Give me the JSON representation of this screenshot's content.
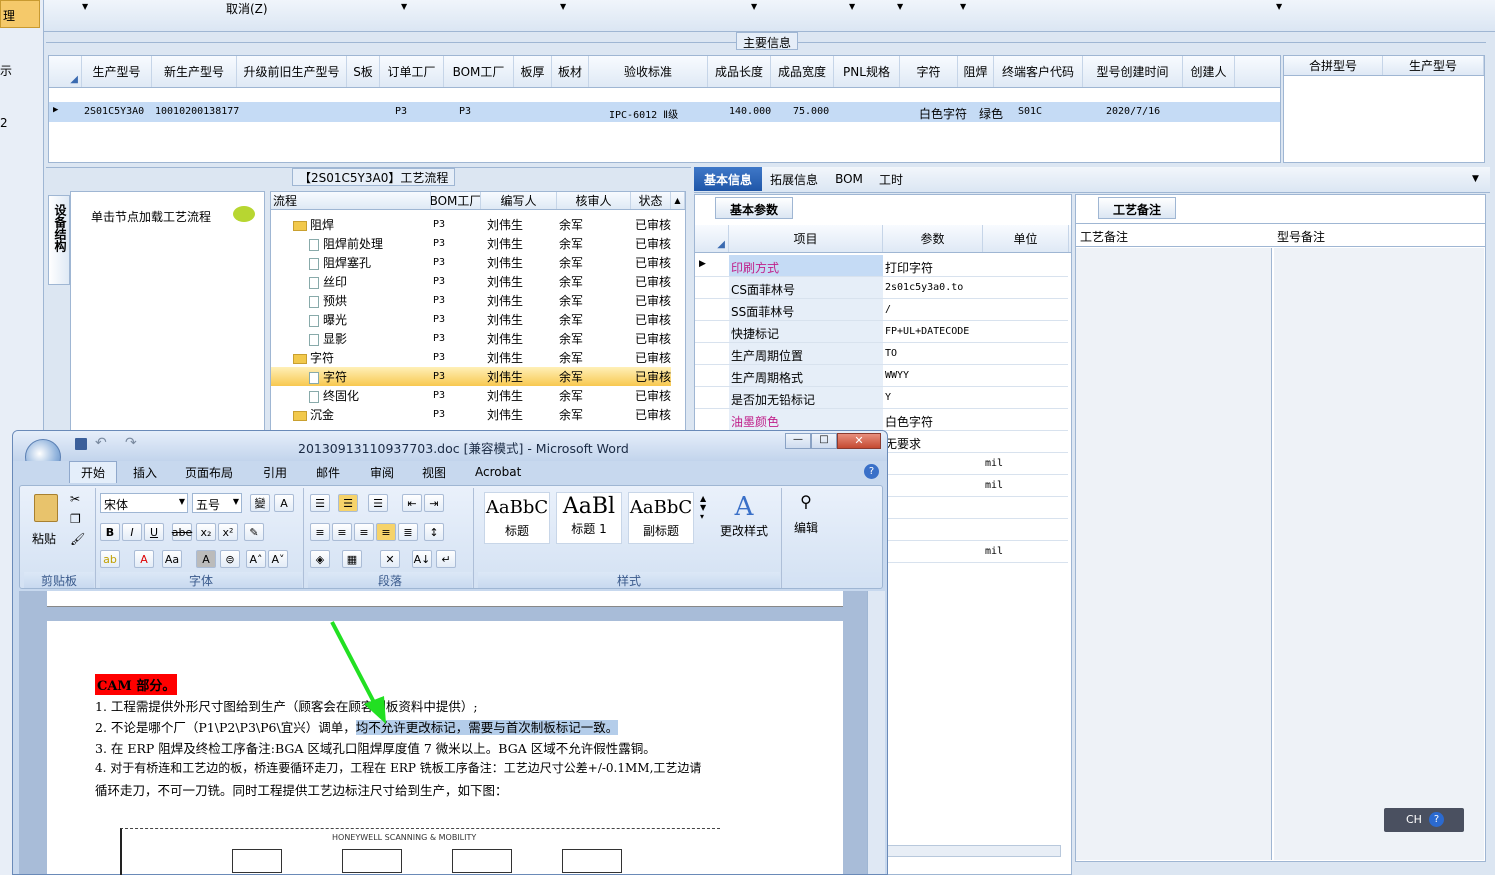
{
  "top_bar": {
    "cancel_label": "取消(Z)",
    "left_labels": [
      "理",
      "示",
      "2"
    ]
  },
  "main_info": {
    "title": "主要信息",
    "columns": [
      "生产型号",
      "新生产型号",
      "升级前旧生产型号",
      "S板",
      "订单工厂",
      "BOM工厂",
      "板厚",
      "板材",
      "验收标准",
      "成品长度",
      "成品宽度",
      "PNL规格",
      "字符",
      "阻焊",
      "终端客户代码",
      "型号创建时间",
      "创建人"
    ],
    "row": {
      "生产型号": "2S01C5Y3A0",
      "新生产型号": "10010200138177",
      "订单工厂": "P3",
      "BOM工厂": "P3",
      "验收标准": "IPC-6012 Ⅱ级",
      "成品长度": "140.000",
      "成品宽度": "75.000",
      "字符": "白色字符",
      "阻焊": "绿色",
      "终端客户代码": "S01C",
      "型号创建时间": "2020/7/16"
    },
    "merge_columns": [
      "合拼型号",
      "生产型号"
    ]
  },
  "process": {
    "title": "【2S01C5Y3A0】工艺流程",
    "side_tab": "设备结构",
    "hint": "单击节点加载工艺流程",
    "columns": [
      "流程",
      "BOM工厂",
      "编写人",
      "核审人",
      "状态"
    ],
    "rows": [
      {
        "name": "阻焊",
        "type": "folder",
        "factory": "P3",
        "writer": "刘伟生",
        "reviewer": "余军",
        "status": "已审核"
      },
      {
        "name": "阻焊前处理",
        "type": "leaf",
        "factory": "P3",
        "writer": "刘伟生",
        "reviewer": "余军",
        "status": "已审核"
      },
      {
        "name": "阻焊塞孔",
        "type": "leaf",
        "factory": "P3",
        "writer": "刘伟生",
        "reviewer": "余军",
        "status": "已审核"
      },
      {
        "name": "丝印",
        "type": "leaf",
        "factory": "P3",
        "writer": "刘伟生",
        "reviewer": "余军",
        "status": "已审核"
      },
      {
        "name": "预烘",
        "type": "leaf",
        "factory": "P3",
        "writer": "刘伟生",
        "reviewer": "余军",
        "status": "已审核"
      },
      {
        "name": "曝光",
        "type": "leaf",
        "factory": "P3",
        "writer": "刘伟生",
        "reviewer": "余军",
        "status": "已审核"
      },
      {
        "name": "显影",
        "type": "leaf",
        "factory": "P3",
        "writer": "刘伟生",
        "reviewer": "余军",
        "status": "已审核"
      },
      {
        "name": "字符",
        "type": "folder",
        "factory": "P3",
        "writer": "刘伟生",
        "reviewer": "余军",
        "status": "已审核"
      },
      {
        "name": "字符",
        "type": "leaf",
        "factory": "P3",
        "writer": "刘伟生",
        "reviewer": "余军",
        "status": "已审核",
        "selected": true
      },
      {
        "name": "终固化",
        "type": "leaf",
        "factory": "P3",
        "writer": "刘伟生",
        "reviewer": "余军",
        "status": "已审核"
      },
      {
        "name": "沉金",
        "type": "folder",
        "factory": "P3",
        "writer": "刘伟生",
        "reviewer": "余军",
        "status": "已审核"
      }
    ]
  },
  "detail_tabs": [
    "基本信息",
    "拓展信息",
    "BOM",
    "工时"
  ],
  "basic_params": {
    "tab": "基本参数",
    "columns": [
      "项目",
      "参数",
      "单位"
    ],
    "rows": [
      {
        "item": "印刷方式",
        "value": "打印字符",
        "unit": "",
        "highlight": true
      },
      {
        "item": "CS面菲林号",
        "value": "2s01c5y3a0.to",
        "unit": ""
      },
      {
        "item": "SS面菲林号",
        "value": "/",
        "unit": ""
      },
      {
        "item": "快捷标记",
        "value": "FP+UL+DATECODE",
        "unit": ""
      },
      {
        "item": "生产周期位置",
        "value": "TO",
        "unit": ""
      },
      {
        "item": "生产周期格式",
        "value": "WWYY",
        "unit": ""
      },
      {
        "item": "是否加无铅标记",
        "value": "Y",
        "unit": ""
      },
      {
        "item": "油墨颜色",
        "value": "白色字符",
        "unit": "",
        "highlight": true
      },
      {
        "item": "",
        "value": "无要求",
        "unit": ""
      },
      {
        "item": "",
        "value": "",
        "unit": "mil"
      },
      {
        "item": "",
        "value": "",
        "unit": "mil"
      },
      {
        "item": "",
        "value": "",
        "unit": ""
      },
      {
        "item": "",
        "value": "",
        "unit": ""
      },
      {
        "item": "",
        "value": "",
        "unit": "mil"
      }
    ]
  },
  "notes": {
    "tab": "工艺备注",
    "col1": "工艺备注",
    "col2": "型号备注"
  },
  "ime": {
    "label": "CH"
  },
  "word": {
    "title": "20130913110937703.doc [兼容模式] - Microsoft Word",
    "tabs": [
      "开始",
      "插入",
      "页面布局",
      "引用",
      "邮件",
      "审阅",
      "视图",
      "Acrobat"
    ],
    "font_name": "宋体",
    "font_size": "五号",
    "groups": {
      "clipboard": "剪贴板",
      "font": "字体",
      "paragraph": "段落",
      "styles": "样式"
    },
    "paste_label": "粘贴",
    "styles": [
      {
        "preview": "AaBbC",
        "name": "标题"
      },
      {
        "preview": "AaBl",
        "name": "标题 1"
      },
      {
        "preview": "AaBbC",
        "name": "副标题"
      }
    ],
    "change_styles": "更改样式",
    "edit": "编辑",
    "doc": {
      "heading": "CAM 部分。",
      "lines": [
        "1.   工程需提供外形尺寸图给到生产（顾客会在顾客制板资料中提供）;",
        "2.   不论是哪个厂（P1\\P2\\P3\\P6\\宜兴）调单，",
        "3.   在 ERP 阻焊及终检工序备注:BGA 区域孔口阻焊厚度值 7 微米以上。BGA 区域不允许假性露铜。",
        "4.   对于有桥连和工艺边的板，桥连要循环走刀，工程在 ERP 铣板工序备注：工艺边尺寸公差+/-0.1MM,工艺边请",
        "循环走刀，不可一刀铣。同时工程提供工艺边标注尺寸给到生产，如下图："
      ],
      "highlighted": "均不允许更改标记，需要与首次制板标记一致。",
      "figure_caption": "HONEYWELL SCANNING & MOBILITY"
    }
  }
}
